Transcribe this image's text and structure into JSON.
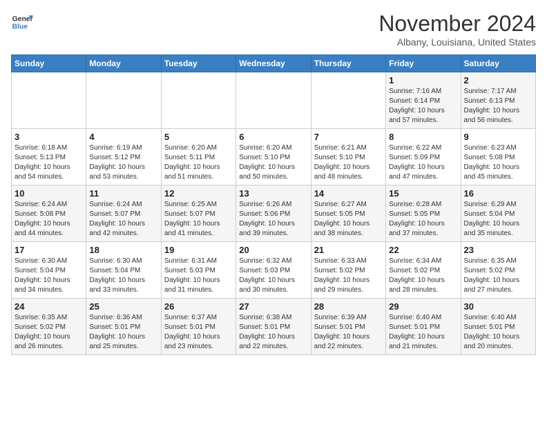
{
  "header": {
    "logo_line1": "General",
    "logo_line2": "Blue",
    "month": "November 2024",
    "location": "Albany, Louisiana, United States"
  },
  "weekdays": [
    "Sunday",
    "Monday",
    "Tuesday",
    "Wednesday",
    "Thursday",
    "Friday",
    "Saturday"
  ],
  "weeks": [
    [
      {
        "day": "",
        "info": ""
      },
      {
        "day": "",
        "info": ""
      },
      {
        "day": "",
        "info": ""
      },
      {
        "day": "",
        "info": ""
      },
      {
        "day": "",
        "info": ""
      },
      {
        "day": "1",
        "info": "Sunrise: 7:16 AM\nSunset: 6:14 PM\nDaylight: 10 hours and 57 minutes."
      },
      {
        "day": "2",
        "info": "Sunrise: 7:17 AM\nSunset: 6:13 PM\nDaylight: 10 hours and 56 minutes."
      }
    ],
    [
      {
        "day": "3",
        "info": "Sunrise: 6:18 AM\nSunset: 5:13 PM\nDaylight: 10 hours and 54 minutes."
      },
      {
        "day": "4",
        "info": "Sunrise: 6:19 AM\nSunset: 5:12 PM\nDaylight: 10 hours and 53 minutes."
      },
      {
        "day": "5",
        "info": "Sunrise: 6:20 AM\nSunset: 5:11 PM\nDaylight: 10 hours and 51 minutes."
      },
      {
        "day": "6",
        "info": "Sunrise: 6:20 AM\nSunset: 5:10 PM\nDaylight: 10 hours and 50 minutes."
      },
      {
        "day": "7",
        "info": "Sunrise: 6:21 AM\nSunset: 5:10 PM\nDaylight: 10 hours and 48 minutes."
      },
      {
        "day": "8",
        "info": "Sunrise: 6:22 AM\nSunset: 5:09 PM\nDaylight: 10 hours and 47 minutes."
      },
      {
        "day": "9",
        "info": "Sunrise: 6:23 AM\nSunset: 5:08 PM\nDaylight: 10 hours and 45 minutes."
      }
    ],
    [
      {
        "day": "10",
        "info": "Sunrise: 6:24 AM\nSunset: 5:08 PM\nDaylight: 10 hours and 44 minutes."
      },
      {
        "day": "11",
        "info": "Sunrise: 6:24 AM\nSunset: 5:07 PM\nDaylight: 10 hours and 42 minutes."
      },
      {
        "day": "12",
        "info": "Sunrise: 6:25 AM\nSunset: 5:07 PM\nDaylight: 10 hours and 41 minutes."
      },
      {
        "day": "13",
        "info": "Sunrise: 6:26 AM\nSunset: 5:06 PM\nDaylight: 10 hours and 39 minutes."
      },
      {
        "day": "14",
        "info": "Sunrise: 6:27 AM\nSunset: 5:05 PM\nDaylight: 10 hours and 38 minutes."
      },
      {
        "day": "15",
        "info": "Sunrise: 6:28 AM\nSunset: 5:05 PM\nDaylight: 10 hours and 37 minutes."
      },
      {
        "day": "16",
        "info": "Sunrise: 6:29 AM\nSunset: 5:04 PM\nDaylight: 10 hours and 35 minutes."
      }
    ],
    [
      {
        "day": "17",
        "info": "Sunrise: 6:30 AM\nSunset: 5:04 PM\nDaylight: 10 hours and 34 minutes."
      },
      {
        "day": "18",
        "info": "Sunrise: 6:30 AM\nSunset: 5:04 PM\nDaylight: 10 hours and 33 minutes."
      },
      {
        "day": "19",
        "info": "Sunrise: 6:31 AM\nSunset: 5:03 PM\nDaylight: 10 hours and 31 minutes."
      },
      {
        "day": "20",
        "info": "Sunrise: 6:32 AM\nSunset: 5:03 PM\nDaylight: 10 hours and 30 minutes."
      },
      {
        "day": "21",
        "info": "Sunrise: 6:33 AM\nSunset: 5:02 PM\nDaylight: 10 hours and 29 minutes."
      },
      {
        "day": "22",
        "info": "Sunrise: 6:34 AM\nSunset: 5:02 PM\nDaylight: 10 hours and 28 minutes."
      },
      {
        "day": "23",
        "info": "Sunrise: 6:35 AM\nSunset: 5:02 PM\nDaylight: 10 hours and 27 minutes."
      }
    ],
    [
      {
        "day": "24",
        "info": "Sunrise: 6:35 AM\nSunset: 5:02 PM\nDaylight: 10 hours and 26 minutes."
      },
      {
        "day": "25",
        "info": "Sunrise: 6:36 AM\nSunset: 5:01 PM\nDaylight: 10 hours and 25 minutes."
      },
      {
        "day": "26",
        "info": "Sunrise: 6:37 AM\nSunset: 5:01 PM\nDaylight: 10 hours and 23 minutes."
      },
      {
        "day": "27",
        "info": "Sunrise: 6:38 AM\nSunset: 5:01 PM\nDaylight: 10 hours and 22 minutes."
      },
      {
        "day": "28",
        "info": "Sunrise: 6:39 AM\nSunset: 5:01 PM\nDaylight: 10 hours and 22 minutes."
      },
      {
        "day": "29",
        "info": "Sunrise: 6:40 AM\nSunset: 5:01 PM\nDaylight: 10 hours and 21 minutes."
      },
      {
        "day": "30",
        "info": "Sunrise: 6:40 AM\nSunset: 5:01 PM\nDaylight: 10 hours and 20 minutes."
      }
    ]
  ]
}
